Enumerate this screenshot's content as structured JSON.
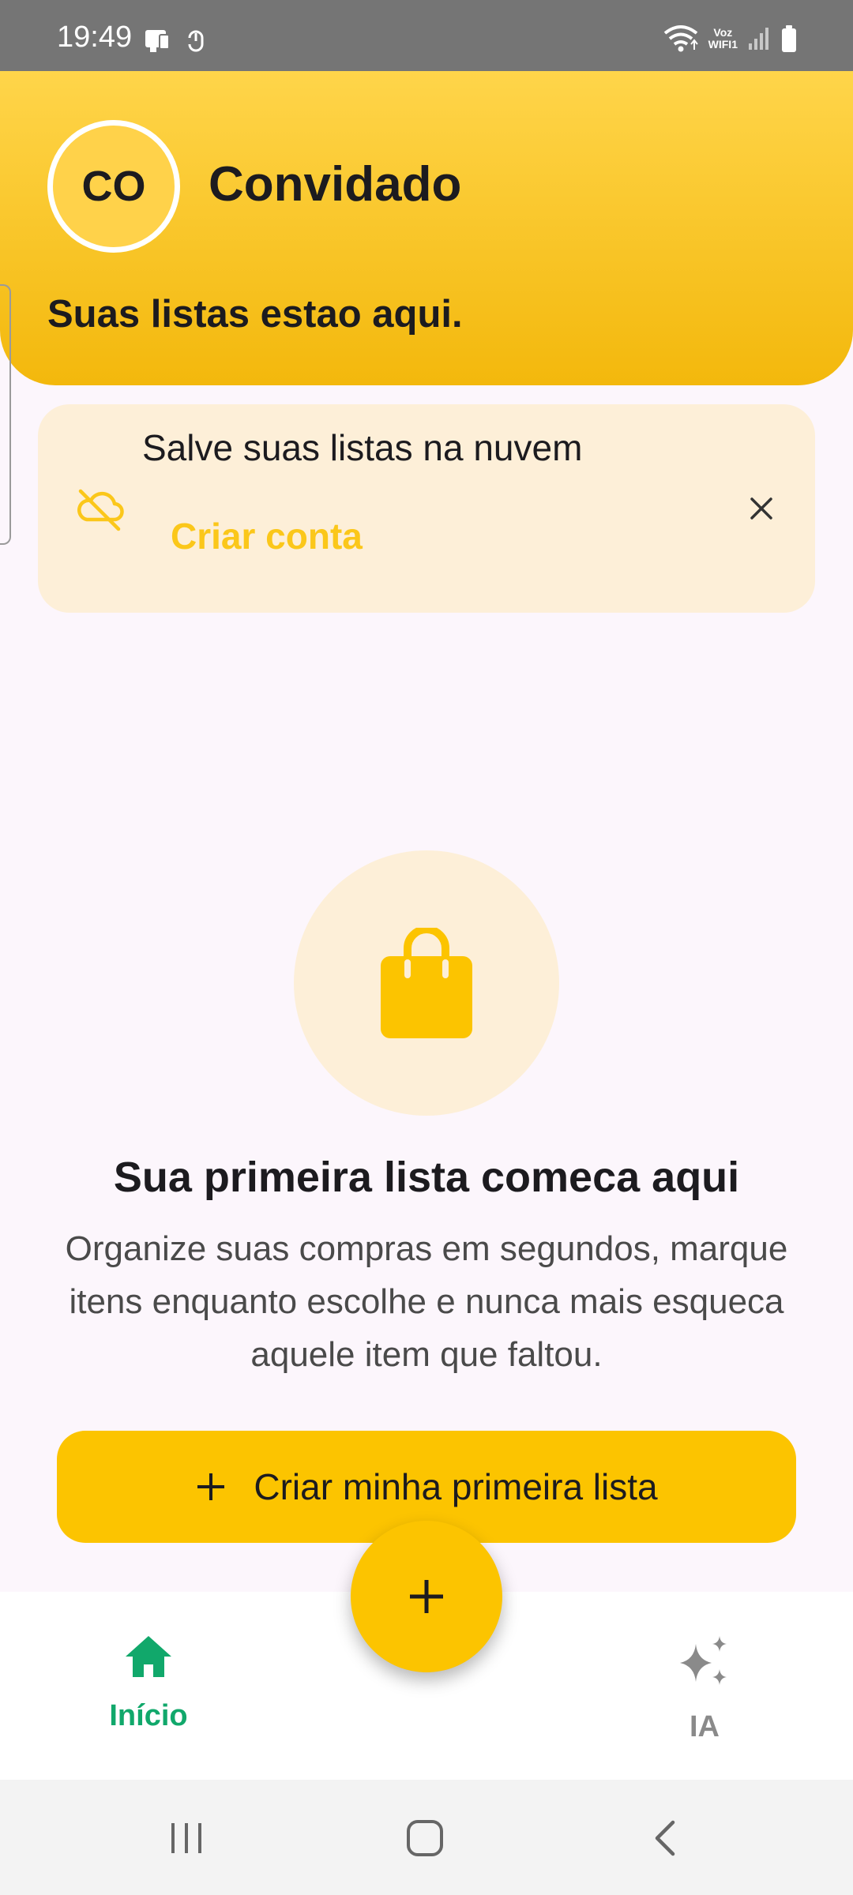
{
  "status_bar": {
    "time": "19:49",
    "voz_label": "Voz",
    "wifi_label": "WIFI1",
    "icons": [
      "card-icon",
      "sync-icon",
      "wifi-icon",
      "signal-icon",
      "battery-icon"
    ]
  },
  "header": {
    "avatar_initials": "CO",
    "user_name": "Convidado",
    "subtitle": "Suas listas estao aqui."
  },
  "cloud_card": {
    "title": "Salve suas listas na nuvem",
    "action": "Criar conta",
    "icon": "cloud-off-icon",
    "close_icon": "close-icon"
  },
  "empty_state": {
    "icon": "shopping-bag-icon",
    "title": "Sua primeira lista comeca aqui",
    "description": "Organize suas compras em segundos, marque itens enquanto escolhe e nunca mais esqueca aquele item que faltou.",
    "button_label": "Criar minha primeira lista"
  },
  "bottom_nav": {
    "items": [
      {
        "label": "Início",
        "icon": "home-icon",
        "active": true
      },
      {
        "label": "IA",
        "icon": "sparkles-icon",
        "active": false
      }
    ],
    "fab_icon": "plus-icon"
  },
  "system_nav": [
    "recent-apps-icon",
    "home-button-icon",
    "back-icon"
  ],
  "colors": {
    "accent": "#fcc400",
    "header_gradient_top": "#ffd54a",
    "header_gradient_bottom": "#f3b80c",
    "card_bg": "#fdefd8",
    "active_nav": "#11a86b",
    "inactive_nav": "#8a8a8a"
  }
}
